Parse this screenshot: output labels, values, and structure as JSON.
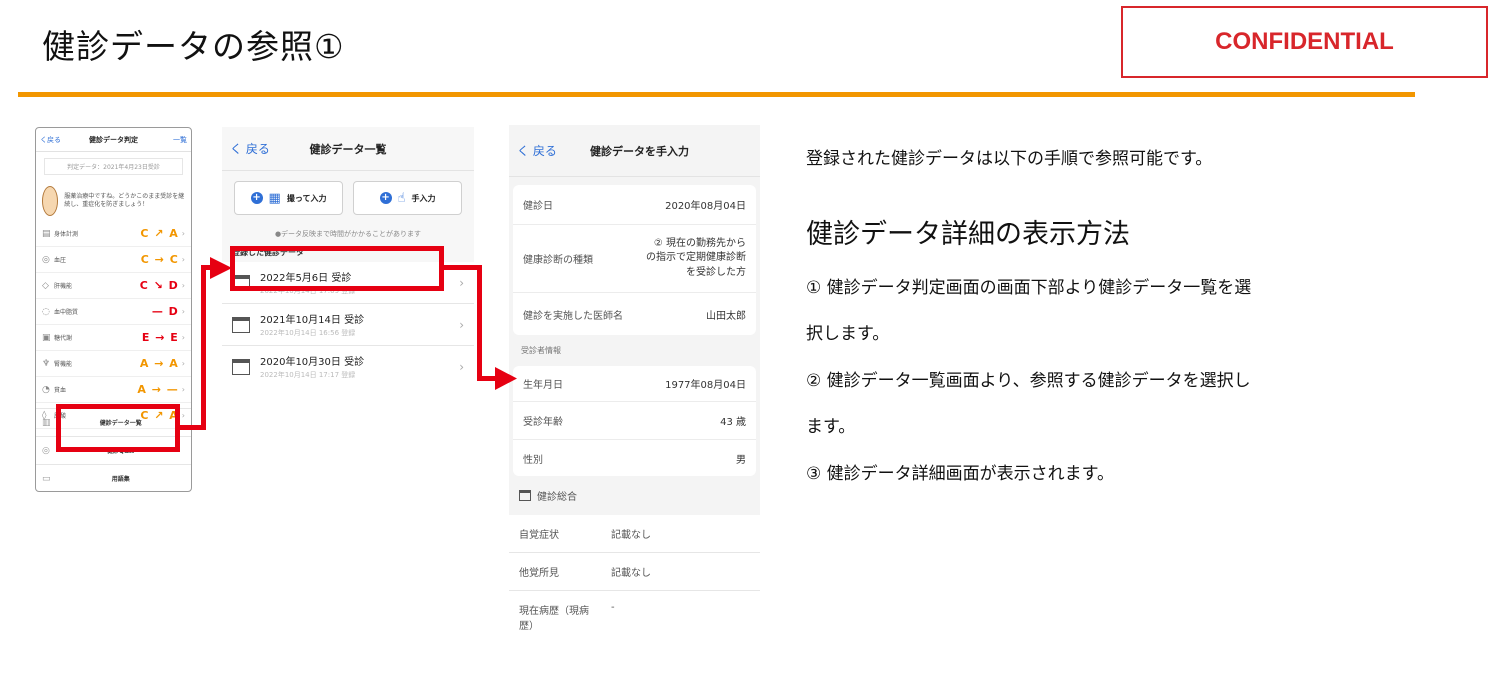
{
  "slide": {
    "title": "健診データの参照①",
    "confidential_label": "CONFIDENTIAL",
    "accent_color": "#f29600",
    "highlight_color": "#e60012"
  },
  "screen1": {
    "back": "く戻る",
    "title": "健診データ判定",
    "list_link": "一覧",
    "date_line": "判定データ：2021年4月23日受診",
    "message": "服薬治療中ですね。どうかこのまま受診を継続し、重症化を防ぎましょう！",
    "grades": [
      {
        "icon": "scale-icon",
        "glyph": "▤",
        "name": "身体計測",
        "value": "C ↗ A",
        "color": "#f29600"
      },
      {
        "icon": "blood-pressure-icon",
        "glyph": "◎",
        "name": "血圧",
        "value": "C → C",
        "color": "#f29600"
      },
      {
        "icon": "liver-icon",
        "glyph": "◇",
        "name": "肝機能",
        "value": "C ↘ D",
        "color": "#e60012"
      },
      {
        "icon": "blood-sugar-icon",
        "glyph": "◌",
        "name": "血中脂質",
        "value": "— D",
        "color": "#e60012"
      },
      {
        "icon": "metabolism-icon",
        "glyph": "▣",
        "name": "糖代謝",
        "value": "E → E",
        "color": "#e60012"
      },
      {
        "icon": "kidney-icon",
        "glyph": "♆",
        "name": "腎機能",
        "value": "A → A",
        "color": "#f29600"
      },
      {
        "icon": "anemia-icon",
        "glyph": "◔",
        "name": "貧血",
        "value": "A → —",
        "color": "#f29600"
      },
      {
        "icon": "urine-icon",
        "glyph": "◊",
        "name": "尿酸",
        "value": "C ↗ A",
        "color": "#f29600"
      }
    ],
    "nav": [
      {
        "label": "健診データ一覧",
        "icon": "list-icon",
        "glyph": "▥"
      },
      {
        "label": "健診Q&A",
        "icon": "qa-icon",
        "glyph": "◎"
      },
      {
        "label": "用語集",
        "icon": "glossary-icon",
        "glyph": "▭"
      }
    ]
  },
  "screen2": {
    "back": "く 戻る",
    "title": "健診データ一覧",
    "btn_photo": "撮って入力",
    "btn_manual": "手入力",
    "note": "●データ反映まで時間がかかることがあります",
    "section": "登録した健診データ",
    "rows": [
      {
        "main": "2022年5月6日 受診",
        "sub": "2022年10月14日 17:09 登録"
      },
      {
        "main": "2021年10月14日 受診",
        "sub": "2022年10月14日 16:56 登録"
      },
      {
        "main": "2020年10月30日 受診",
        "sub": "2022年10月14日 17:17 登録"
      }
    ]
  },
  "screen3": {
    "back": "く 戻る",
    "title": "健診データを手入力",
    "exam_date_label": "健診日",
    "exam_date_value": "2020年08月04日",
    "exam_type_label": "健康診断の種類",
    "exam_type_value_1": "② 現在の勤務先から",
    "exam_type_value_2": "の指示で定期健康診断",
    "exam_type_value_3": "を受診した方",
    "doctor_label": "健診を実施した医師名",
    "doctor_value": "山田太郎",
    "examinee_section": "受診者情報",
    "birth_label": "生年月日",
    "birth_value": "1977年08月04日",
    "age_label": "受診年齢",
    "age_value": "43 歳",
    "sex_label": "性別",
    "sex_value": "男",
    "summary_title": "健診総合",
    "summary_rows": [
      {
        "k": "自覚症状",
        "v": "記載なし"
      },
      {
        "k": "他覚所見",
        "v": "記載なし"
      },
      {
        "k": "現在病歴（現病歴）",
        "v": "-"
      }
    ]
  },
  "explanation": {
    "intro": "登録された健診データは以下の手順で参照可能です。",
    "subheading": "健診データ詳細の表示方法",
    "step1_line1": "① 健診データ判定画面の画面下部より健診データ一覧を選",
    "step1_line2": "択します。",
    "step2_line1": "② 健診データ一覧画面より、参照する健診データを選択し",
    "step2_line2": "ます。",
    "step3": "③ 健診データ詳細画面が表示されます。"
  }
}
